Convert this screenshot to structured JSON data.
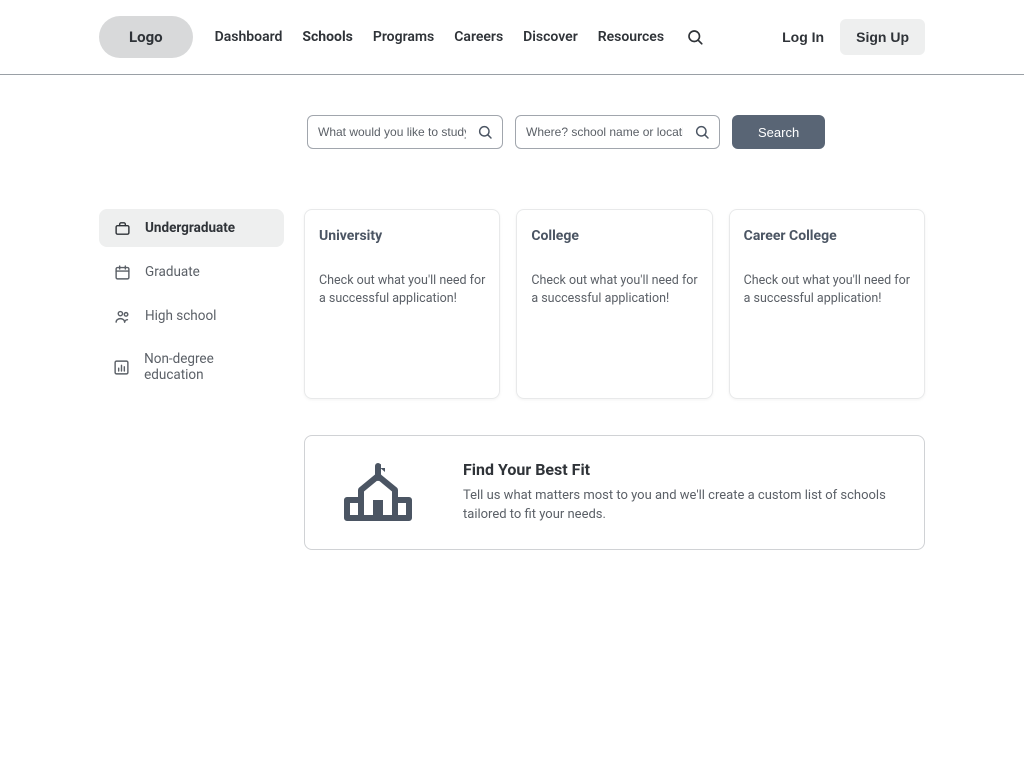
{
  "header": {
    "logo": "Logo",
    "nav": [
      "Dashboard",
      "Schools",
      "Programs",
      "Careers",
      "Discover",
      "Resources"
    ],
    "active_nav_index": 1,
    "login_label": "Log In",
    "signup_label": "Sign Up"
  },
  "search": {
    "study_placeholder": "What would you like to study?",
    "where_placeholder": "Where? school name or location",
    "search_label": "Search"
  },
  "sidebar": {
    "items": [
      {
        "label": "Undergraduate",
        "icon": "briefcase-icon"
      },
      {
        "label": "Graduate",
        "icon": "calendar-icon"
      },
      {
        "label": "High school",
        "icon": "people-icon"
      },
      {
        "label": "Non-degree education",
        "icon": "chart-icon"
      }
    ],
    "active_index": 0
  },
  "cards": [
    {
      "title": "University",
      "desc": "Check out what you'll need for a successful application!"
    },
    {
      "title": "College",
      "desc": "Check out what you'll need for a successful application!"
    },
    {
      "title": "Career College",
      "desc": "Check out what you'll need for a successful application!"
    }
  ],
  "fit": {
    "title": "Find Your Best Fit",
    "desc": "Tell us what matters most to you and we'll create a custom list of schools tailored to fit your needs."
  }
}
